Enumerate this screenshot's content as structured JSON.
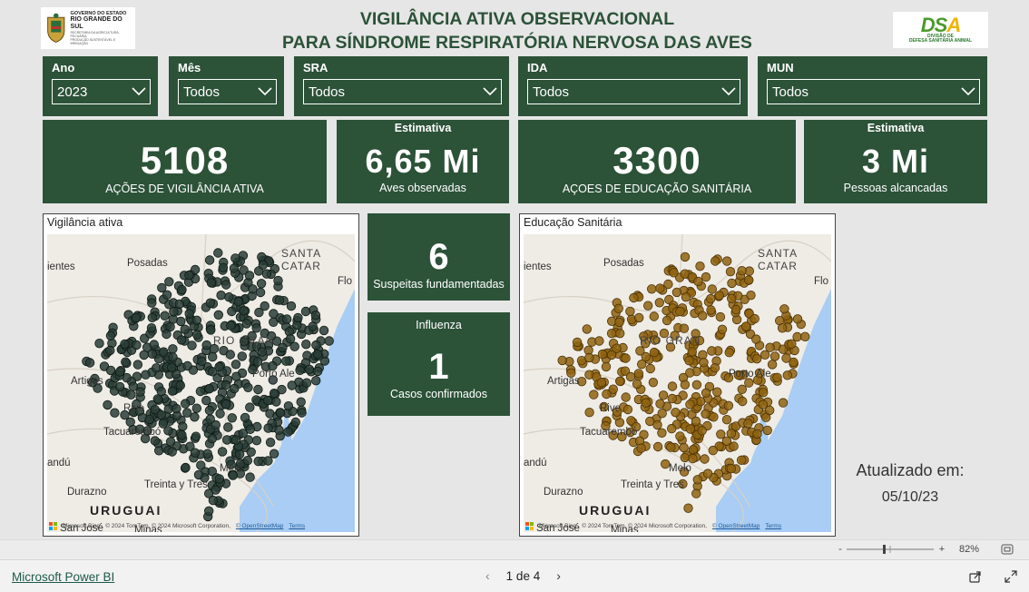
{
  "header": {
    "title_line1": "VIGILÂNCIA ATIVA OBSERVACIONAL",
    "title_line2": "PARA SÍNDROME RESPIRATÓRIA NERVOSA DAS AVES",
    "logo_left_l1": "GOVERNO DO ESTADO",
    "logo_left_l2": "RIO GRANDE DO SUL",
    "logo_left_l3": "SECRETARIA DA AGRICULTURA, PECUÁRIA,",
    "logo_left_l4": "PRODUÇÃO SUSTENTÁVEL E IRRIGAÇÃO",
    "logo_right_mark_a": "DS",
    "logo_right_mark_b": "A",
    "logo_right_sub1": "DIVISÃO DE",
    "logo_right_sub2": "DEFESA SANITÁRIA ANIMAL"
  },
  "slicers": [
    {
      "label": "Ano",
      "value": "2023"
    },
    {
      "label": "Mês",
      "value": "Todos"
    },
    {
      "label": "SRA",
      "value": "Todos"
    },
    {
      "label": "IDA",
      "value": "Todos"
    },
    {
      "label": "MUN",
      "value": "Todos"
    }
  ],
  "kpis": {
    "acoes_vigilancia": {
      "value": "5108",
      "label": "AÇÕES DE VIGILÂNCIA ATIVA"
    },
    "aves": {
      "header": "Estimativa",
      "value": "6,65 Mi",
      "label": "Aves observadas"
    },
    "acoes_educacao": {
      "value": "3300",
      "label": "AÇOES DE EDUCAÇÃO SANITÁRIA"
    },
    "pessoas": {
      "header": "Estimativa",
      "value": "3 Mi",
      "label": "Pessoas alcancadas"
    }
  },
  "suspeitas": {
    "value": "6",
    "label": "Suspeitas fundamentadas"
  },
  "influenza": {
    "header": "Influenza",
    "value": "1",
    "label": "Casos confirmados"
  },
  "maps": [
    {
      "title": "Vigilância ativa",
      "dot_color": "#2a3d36",
      "dot_edge": "#0e1a15"
    },
    {
      "title": "Educação Sanitária",
      "dot_color": "#8f6410",
      "dot_edge": "#4d3306"
    }
  ],
  "map_labels": {
    "posadas": "Posadas",
    "santa_catarina": "SANTA CATAR",
    "flo": "Flo",
    "ientes": "ientes",
    "rio_grande": "RIO GRAN",
    "porto_alegre": "Porto Ale",
    "artigas": "Artigas",
    "rivera": "Rive",
    "tacuarembo": "Tacuarembó",
    "melo": "Melo",
    "andu": "andú",
    "treinta": "Treinta y Tres",
    "durazno": "Durazno",
    "uruguai": "URUGUAI",
    "san_jose": "San José",
    "minas": "Minas",
    "bing": "Microsoft Bing",
    "credit": "© 2024 TomTom, © 2024 Microsoft Corporation,",
    "osm": "© OpenStreetMap",
    "terms": "Terms"
  },
  "updated": {
    "label": "Atualizado em:",
    "date": "05/10/23"
  },
  "zoom": {
    "minus": "-",
    "plus": "+",
    "level": "82%",
    "fraction": 0.5
  },
  "footer": {
    "brand": "Microsoft Power BI",
    "page": "1 de 4"
  },
  "colors": {
    "panel": "#2c5238",
    "title": "#2c5238",
    "land": "#efece6",
    "water": "#a9cdf4"
  }
}
